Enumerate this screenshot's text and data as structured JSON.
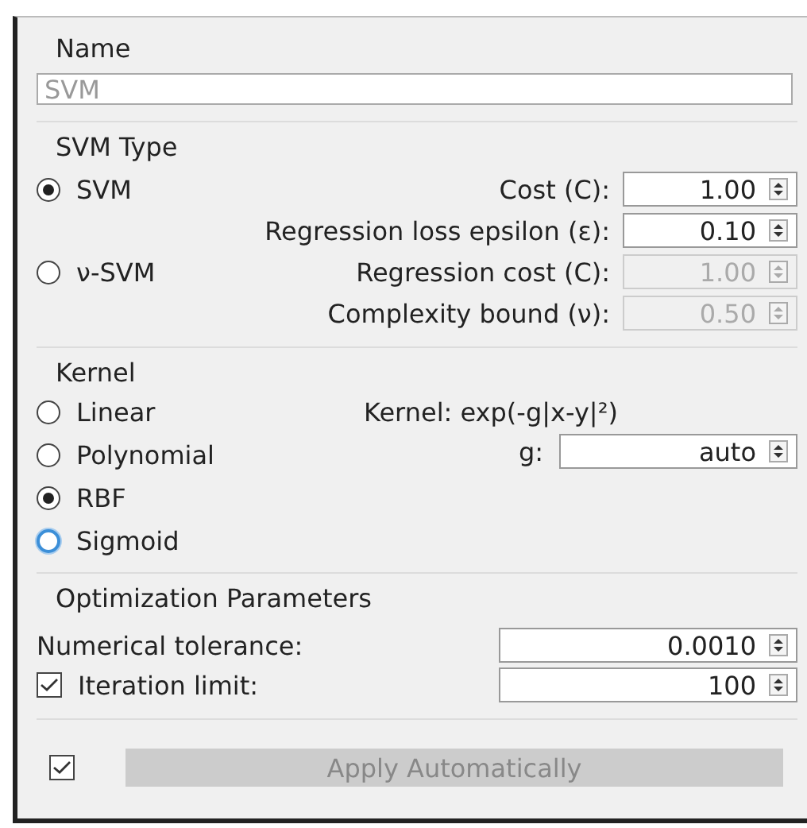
{
  "name_box": {
    "title": "Name",
    "placeholder": "SVM"
  },
  "svm_type": {
    "title": "SVM Type",
    "options": [
      {
        "label": "SVM",
        "selected": true,
        "params": [
          {
            "label": "Cost (C):",
            "value": "1.00",
            "disabled": false
          },
          {
            "label": "Regression loss epsilon (ε):",
            "value": "0.10",
            "disabled": false
          }
        ]
      },
      {
        "label": "ν-SVM",
        "selected": false,
        "params": [
          {
            "label": "Regression cost (C):",
            "value": "1.00",
            "disabled": true
          },
          {
            "label": "Complexity bound (ν):",
            "value": "0.50",
            "disabled": true
          }
        ]
      }
    ]
  },
  "kernel": {
    "title": "Kernel",
    "options": [
      {
        "label": "Linear",
        "selected": false,
        "focused": false
      },
      {
        "label": "Polynomial",
        "selected": false,
        "focused": false
      },
      {
        "label": "RBF",
        "selected": true,
        "focused": false
      },
      {
        "label": "Sigmoid",
        "selected": false,
        "focused": true
      }
    ],
    "formula": "Kernel: exp(-g|x-y|²)",
    "params": [
      {
        "label": "g:",
        "value": "auto"
      }
    ]
  },
  "optimization": {
    "title": "Optimization Parameters",
    "rows": [
      {
        "kind": "plain",
        "label": "Numerical tolerance:",
        "value": "0.0010"
      },
      {
        "kind": "checkbox",
        "label": "Iteration limit:",
        "checked": true,
        "value": "100"
      }
    ]
  },
  "footer": {
    "auto_apply_checked": true,
    "button": {
      "label": "Apply Automatically",
      "disabled": true
    }
  }
}
